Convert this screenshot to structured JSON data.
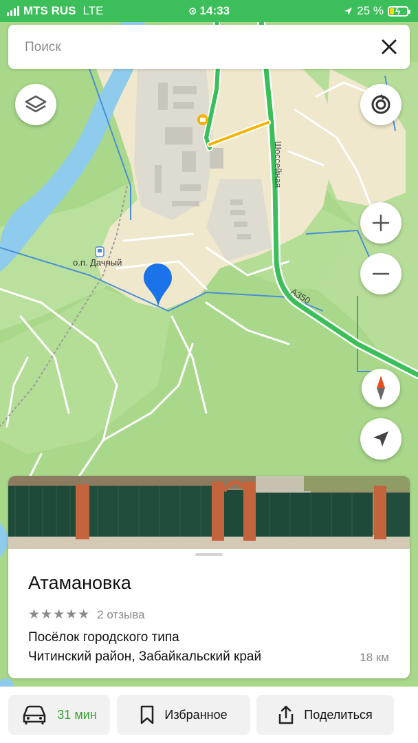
{
  "status_bar": {
    "carrier": "MTS RUS",
    "network": "LTE",
    "time": "14:33",
    "battery_percent": "25 %",
    "battery_level": 0.25,
    "icons": [
      "signal-bars-icon",
      "hotspot-link-icon",
      "location-arrow-icon",
      "battery-charging-icon"
    ]
  },
  "search": {
    "placeholder": "Поиск",
    "close_icon": "close-x-icon"
  },
  "map": {
    "labels": {
      "station": "о.п. Дачный",
      "street": "Шоссейная",
      "highway": "А350"
    },
    "controls": [
      "layers-icon",
      "traffic-icon",
      "zoom-in-icon",
      "zoom-out-icon",
      "compass-icon",
      "my-location-icon"
    ],
    "colors": {
      "land_green": "#a9d88a",
      "river": "#8fcbec",
      "settlement": "#efe8cc",
      "industrial": "#dcdcdc",
      "road_green": "#3cbf5a",
      "road_yellow": "#f5b400",
      "pin": "#1a73e8",
      "boundary": "#4a8ed6"
    }
  },
  "place_card": {
    "title": "Атамановка",
    "stars": "★★★★★",
    "reviews": "2 отзыва",
    "type": "Посёлок городского типа",
    "region": "Читинский район, Забайкальский край",
    "distance": "18 км"
  },
  "actions": {
    "route": {
      "icon": "car-icon",
      "label": "31 мин"
    },
    "favorite": {
      "icon": "bookmark-icon",
      "label": "Избранное"
    },
    "share": {
      "icon": "share-icon",
      "label": "Поделиться"
    }
  }
}
